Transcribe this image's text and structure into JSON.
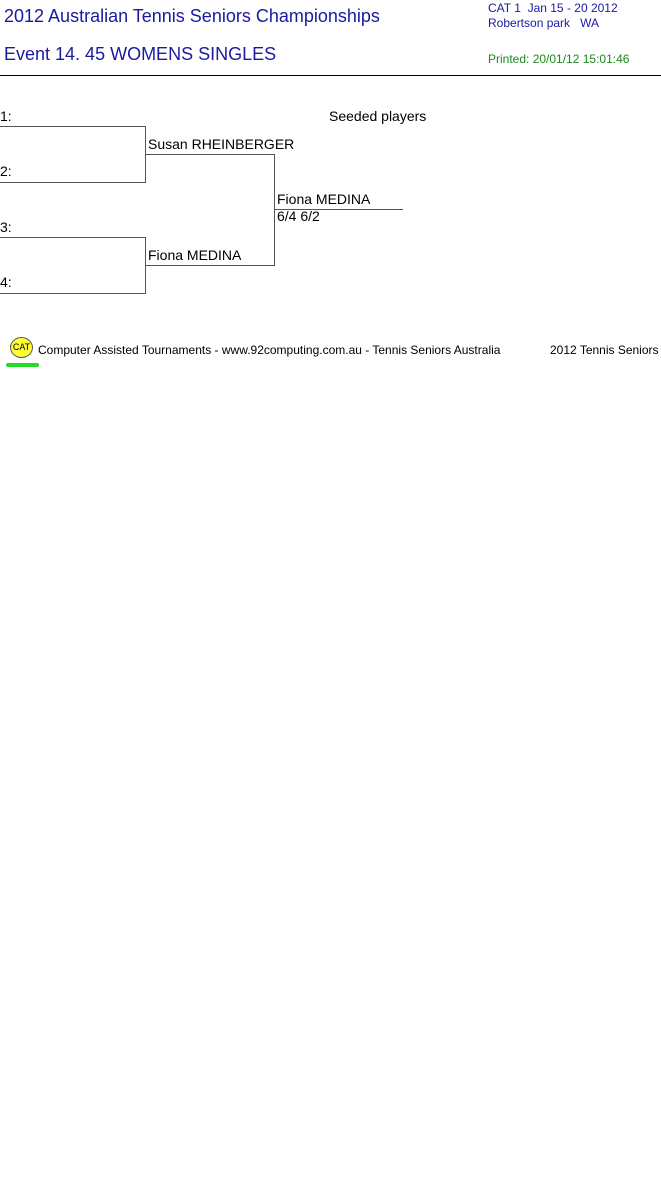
{
  "header": {
    "title": "2012 Australian Tennis Seniors Championships",
    "event": "Event 14. 45 WOMENS SINGLES",
    "category": "CAT 1",
    "dates": "Jan 15 - 20 2012",
    "venue": "Robertson park",
    "state": "WA",
    "printed": "Printed: 20/01/12 15:01:46"
  },
  "draw": {
    "seeded_label": "Seeded players",
    "slots": [
      {
        "label": "1:"
      },
      {
        "label": "2:"
      },
      {
        "label": "3:"
      },
      {
        "label": "4:"
      }
    ],
    "round2": [
      {
        "name": "Susan RHEINBERGER"
      },
      {
        "name": "Fiona MEDINA"
      }
    ],
    "final": {
      "name": "Fiona MEDINA",
      "score": "6/4 6/2"
    }
  },
  "footer": {
    "logo_text": "CAT",
    "text": "Computer Assisted Tournaments - www.92computing.com.au -  Tennis Seniors Australia",
    "right_text": "2012 Tennis Seniors"
  }
}
